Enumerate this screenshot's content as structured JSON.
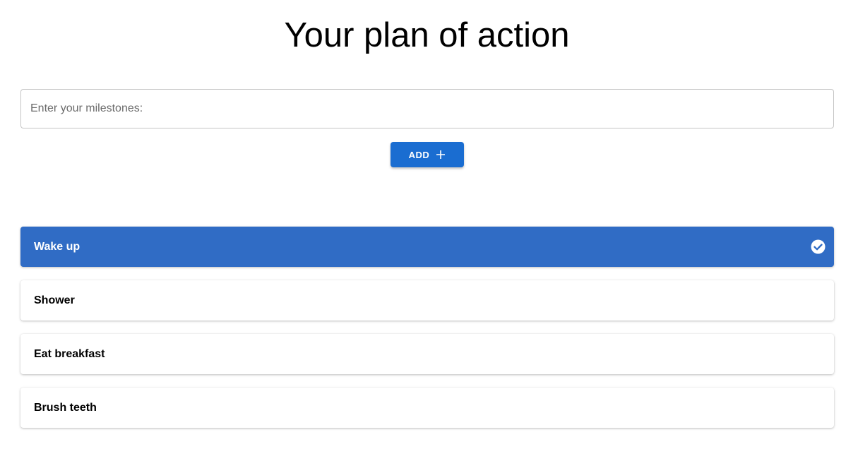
{
  "page": {
    "title": "Your plan of action"
  },
  "form": {
    "input_placeholder": "Enter your milestones:",
    "input_value": "",
    "add_button_label": "ADD",
    "add_icon": "plus-icon"
  },
  "milestones": [
    {
      "label": "Wake up",
      "completed": true,
      "status_icon": "check-circle-icon"
    },
    {
      "label": "Shower",
      "completed": false
    },
    {
      "label": "Eat breakfast",
      "completed": false
    },
    {
      "label": "Brush teeth",
      "completed": false
    }
  ],
  "colors": {
    "accent": "#1a6dd1",
    "completed": "#306cc5",
    "text": "#000000",
    "background": "#ffffff"
  }
}
